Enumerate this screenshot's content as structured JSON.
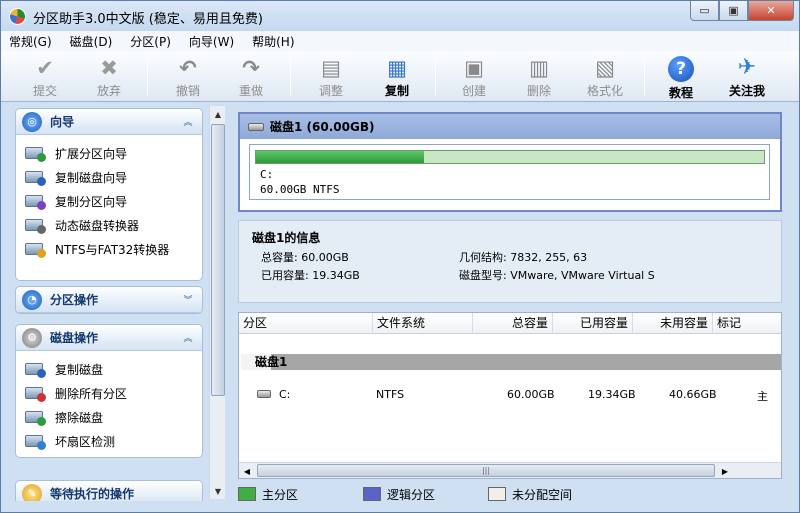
{
  "window": {
    "title": "分区助手3.0中文版 (稳定、易用且免费)",
    "controls": {
      "minimize": "▭",
      "maximize": "▣",
      "close": "✕"
    }
  },
  "menu": [
    "常规(G)",
    "磁盘(D)",
    "分区(P)",
    "向导(W)",
    "帮助(H)"
  ],
  "toolbar": {
    "submit": "提交",
    "discard": "放弃",
    "undo": "撤销",
    "redo": "重做",
    "adjust": "调整",
    "copy": "复制",
    "create": "创建",
    "delete": "删除",
    "format": "格式化",
    "tutorial": "教程",
    "follow": "关注我"
  },
  "sidebar": {
    "wizard": {
      "title": "向导",
      "items": [
        "扩展分区向导",
        "复制磁盘向导",
        "复制分区向导",
        "动态磁盘转换器",
        "NTFS与FAT32转换器"
      ]
    },
    "partition_ops": {
      "title": "分区操作"
    },
    "disk_ops": {
      "title": "磁盘操作",
      "items": [
        "复制磁盘",
        "删除所有分区",
        "擦除磁盘",
        "坏扇区检测"
      ]
    },
    "pending": {
      "title": "等待执行的操作"
    }
  },
  "disk_view": {
    "header": "磁盘1 (60.00GB)",
    "partition_letter": "C:",
    "partition_desc": "60.00GB NTFS",
    "used_fraction": 0.33
  },
  "disk_info": {
    "title": "磁盘1的信息",
    "total": "总容量: 60.00GB",
    "used": "已用容量: 19.34GB",
    "geometry": "几何结构: 7832, 255, 63",
    "model": "磁盘型号: VMware, VMware Virtual S"
  },
  "grid": {
    "columns": [
      "分区",
      "文件系统",
      "总容量",
      "已用容量",
      "未用容量",
      "标记"
    ],
    "group": "磁盘1",
    "rows": [
      {
        "partition": "C:",
        "fs": "NTFS",
        "total": "60.00GB",
        "used": "19.34GB",
        "free": "40.66GB",
        "flag": "主"
      }
    ]
  },
  "legend": {
    "primary": "主分区",
    "logical": "逻辑分区",
    "unallocated": "未分配空间"
  },
  "colors": {
    "primary": "#3fae44",
    "logical": "#5a64c8",
    "unallocated": "#f2eee8",
    "accent": "#2b5a99"
  }
}
